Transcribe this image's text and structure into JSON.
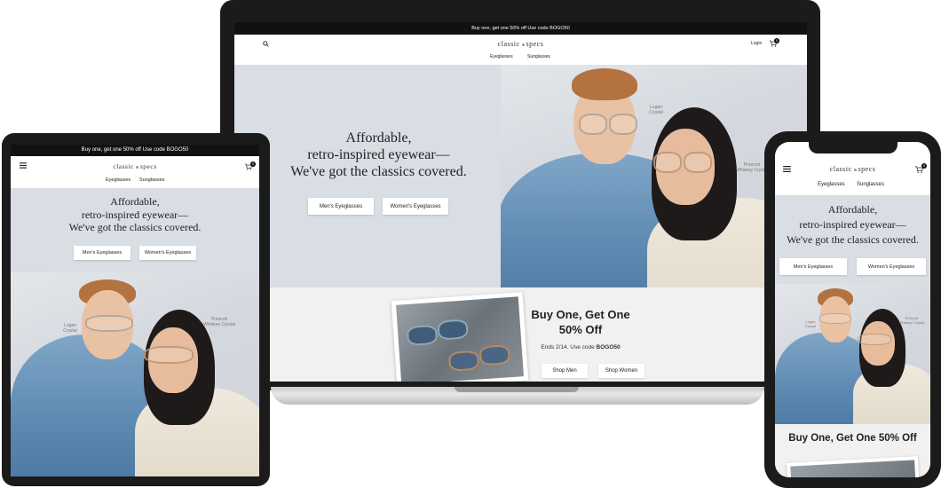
{
  "promo": "Buy one, get one 50% off Use code BOGO50",
  "logo": {
    "left": "classic",
    "right": "specs"
  },
  "nav": {
    "login": "Login",
    "cart_count": "0",
    "eyeglasses": "Eyeglasses",
    "sunglasses": "Sunglasses"
  },
  "hero": {
    "line1": "Affordable,",
    "line2": "retro-inspired eyewear—",
    "line3": "We've got the classics covered.",
    "btn_men": "Men's Eyeglasses",
    "btn_women": "Women's Eyeglasses"
  },
  "frames": {
    "logan_name": "Logan",
    "logan_color": "Crystal",
    "prescott_name": "Prescott",
    "prescott_color": "Whiskey Crystal"
  },
  "bogo": {
    "title_line1": "Buy One, Get One",
    "title_line2": "50% Off",
    "ends": "Ends 2/14. Use code ",
    "code": "BOGO50",
    "shop_men": "Shop Men",
    "shop_women": "Shop Women",
    "mobile_title": "Buy One, Get One 50% Off"
  },
  "colors": {
    "promo_bg": "#111111",
    "hero_bg": "#d9dde4",
    "device_frame": "#1a1a1a",
    "denim": "#5f8bb2"
  }
}
